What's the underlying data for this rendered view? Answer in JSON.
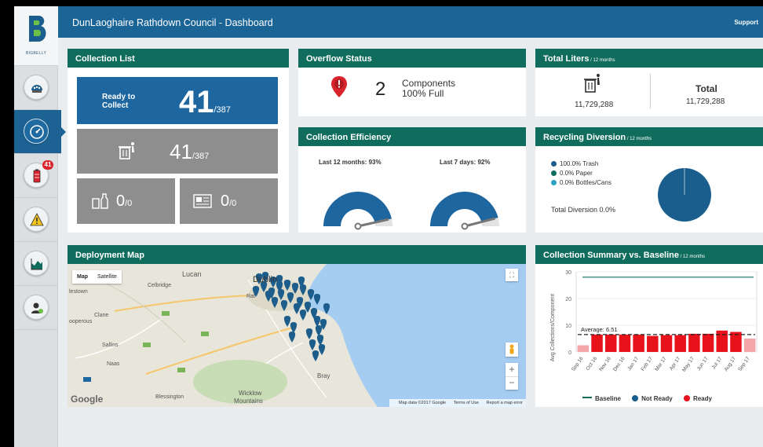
{
  "header": {
    "title": "DunLaoghaire Rathdown Council - Dashboard",
    "support": "Support"
  },
  "logo": {
    "text": "BIGBELLY"
  },
  "sidebar": {
    "items": [
      {
        "name": "collection-list",
        "icon": "bins-icon",
        "active": false
      },
      {
        "name": "dashboard",
        "icon": "gauge-icon",
        "active": true
      },
      {
        "name": "fullness",
        "icon": "battery-icon",
        "badge": "41"
      },
      {
        "name": "alerts",
        "icon": "warning-icon"
      },
      {
        "name": "reports",
        "icon": "chart-icon"
      },
      {
        "name": "users",
        "icon": "user-icon"
      }
    ]
  },
  "collection_list": {
    "title": "Collection List",
    "ready_label_1": "Ready to",
    "ready_label_2": "Collect",
    "ready_value": "41",
    "ready_total": "/387",
    "trash_value": "41",
    "trash_total": "/387",
    "bottles_value": "0",
    "bottles_total": "/0",
    "paper_value": "0",
    "paper_total": "/0"
  },
  "overflow": {
    "title": "Overflow Status",
    "count": "2",
    "line1": "Components",
    "line2": "100% Full"
  },
  "total_liters": {
    "title": "Total Liters",
    "sub": " / 12 months",
    "trash_value": "11,729,288",
    "total_label": "Total",
    "total_value": "11,729,288"
  },
  "efficiency": {
    "title": "Collection Efficiency",
    "left_label": "Last 12 months: 93%",
    "right_label": "Last 7 days: 92%",
    "left_pct": 93,
    "right_pct": 92
  },
  "recycling": {
    "title": "Recycling Diversion",
    "sub": " / 12 months",
    "legend": [
      {
        "label": "100.0% Trash",
        "color": "#1a5e8e"
      },
      {
        "label": "0.0% Paper",
        "color": "#106d5d"
      },
      {
        "label": "0.0% Bottles/Cans",
        "color": "#27a2c4"
      }
    ],
    "total_diversion": "Total Diversion 0.0%"
  },
  "map": {
    "title": "Deployment Map",
    "type_map": "Map",
    "type_sat": "Satellite",
    "labels": {
      "lucan": "Lucan",
      "dublin": "Dublin",
      "celbridge": "Celbridge",
      "leixlip": "lestown",
      "clane": "Clane",
      "cooperous": "ooperous",
      "sallins": "Sallins",
      "naas": "Naas",
      "blessington": "Blessington",
      "wicklow": "Wicklow",
      "mountains": "Mountains",
      "bray": "Bray",
      "rat": "Rat"
    },
    "attribution": "Map data ©2017 Google",
    "terms": "Terms of Use",
    "report": "Report a map error",
    "google": "Google",
    "zoom_in": "+",
    "zoom_out": "−"
  },
  "summary": {
    "title": "Collection Summary vs. Baseline",
    "sub": " / 12 months",
    "average_label": "Average: 6.51",
    "legend_baseline": "Baseline",
    "legend_not_ready": "Not Ready",
    "legend_ready": "Ready"
  },
  "chart_data": {
    "type": "bar",
    "ylabel": "Avg Collections/Component",
    "ylim": [
      0,
      30
    ],
    "yticks": [
      0,
      10,
      20,
      30
    ],
    "categories": [
      "Sep 16",
      "Oct 16",
      "Nov 16",
      "Dec 16",
      "Jan 17",
      "Feb 17",
      "Mar 17",
      "Apr 17",
      "May 17",
      "Jun 17",
      "Jul 17",
      "Aug 17",
      "Sep 17"
    ],
    "series": [
      {
        "name": "Ready",
        "values": [
          2.5,
          6.5,
          6.5,
          6.5,
          6.5,
          6.0,
          6.3,
          6.3,
          6.8,
          6.8,
          8.0,
          7.5,
          5.0
        ],
        "color": "#e8121b"
      }
    ],
    "baseline": 28,
    "average": 6.51
  }
}
